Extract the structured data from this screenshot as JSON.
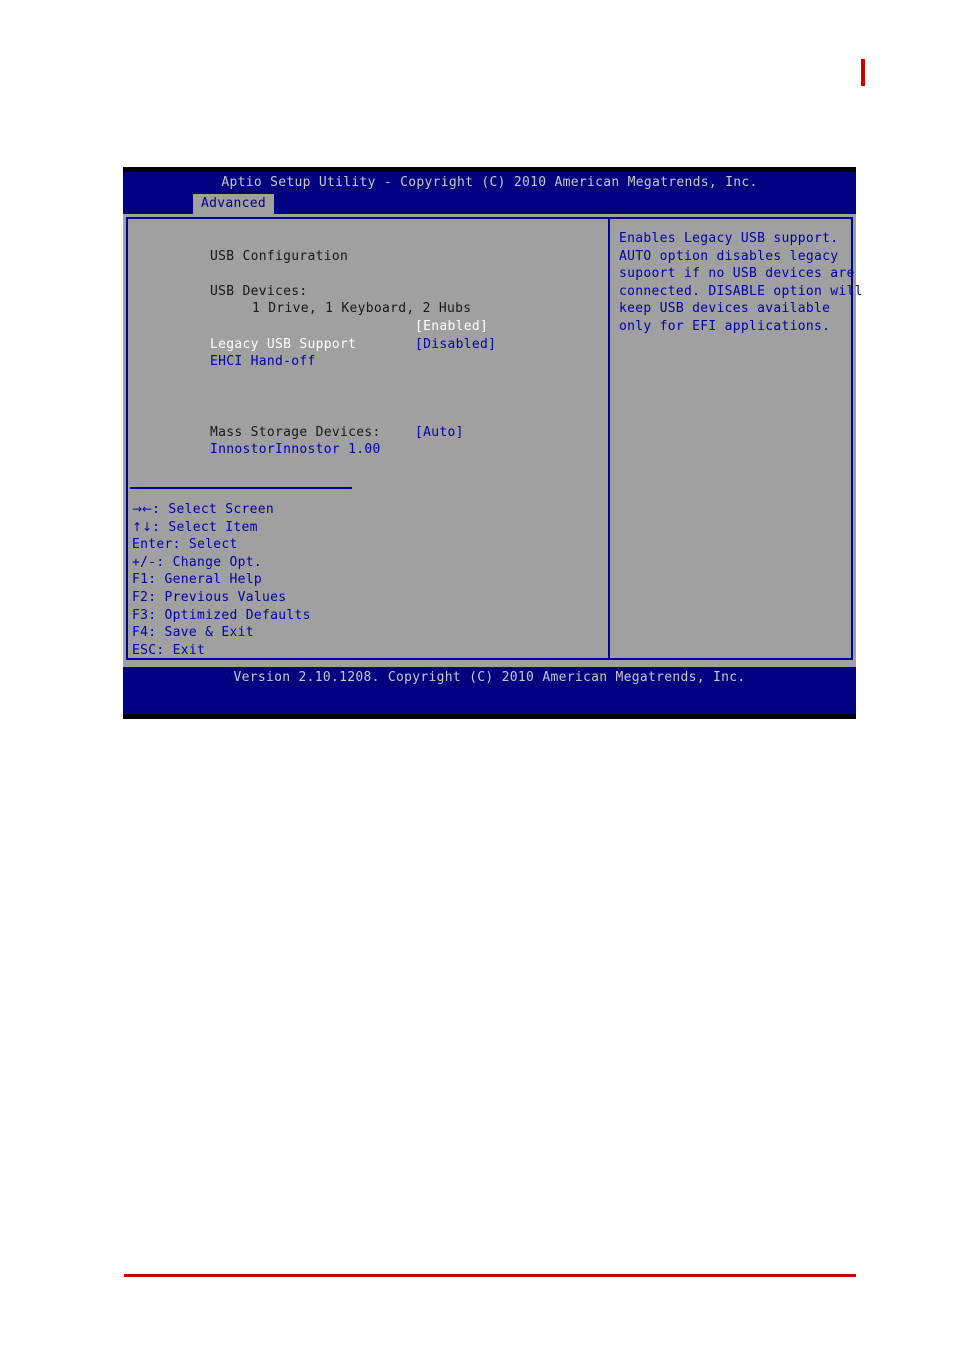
{
  "page": {
    "top_mark_color": "#cc0000",
    "bottom_rule_color": "#cc0000"
  },
  "bios": {
    "title": "Aptio Setup Utility - Copyright (C) 2010 American Megatrends, Inc.",
    "footer": "Version 2.10.1208. Copyright (C) 2010 American Megatrends, Inc.",
    "tabs": [
      {
        "label": "Advanced",
        "active": true
      }
    ],
    "colors": {
      "screen_blue": "#000080",
      "body_gray": "#a0a0a0",
      "border_blue": "#0000a0",
      "text_blue": "#0000a8",
      "text_dark": "#181818",
      "text_selected": "#ffffff",
      "title_text": "#c8c8c8"
    },
    "left_pane": {
      "section_title": "USB Configuration",
      "devices_header": "USB Devices:",
      "devices_summary": "1 Drive, 1 Keyboard, 2 Hubs",
      "settings": [
        {
          "label": "Legacy USB Support",
          "value": "[Enabled]",
          "selected": true
        },
        {
          "label": "EHCI Hand-off",
          "value": "[Disabled]",
          "selected": false
        }
      ],
      "mass_storage_header": "Mass Storage Devices:",
      "mass_storage": [
        {
          "label": "InnostorInnostor 1.00",
          "value": "[Auto]"
        }
      ]
    },
    "right_pane": {
      "help_lines": [
        "Enables Legacy USB support.",
        "AUTO option disables legacy",
        "supoort if no USB devices are",
        "connected. DISABLE option will",
        "keep USB devices available",
        "only for EFI applications."
      ],
      "nav_keys": [
        {
          "key": "→←",
          "glyph": true,
          "text": ": Select Screen"
        },
        {
          "key": "↑↓",
          "glyph": true,
          "text": ": Select Item"
        },
        {
          "key": "Enter",
          "glyph": false,
          "text": ": Select"
        },
        {
          "key": "+/-",
          "glyph": false,
          "text": ": Change Opt."
        },
        {
          "key": "F1",
          "glyph": false,
          "text": ": General Help"
        },
        {
          "key": "F2",
          "glyph": false,
          "text": ": Previous Values"
        },
        {
          "key": "F3",
          "glyph": false,
          "text": ": Optimized Defaults"
        },
        {
          "key": "F4",
          "glyph": false,
          "text": ": Save & Exit"
        },
        {
          "key": "ESC",
          "glyph": false,
          "text": ": Exit"
        }
      ]
    }
  }
}
